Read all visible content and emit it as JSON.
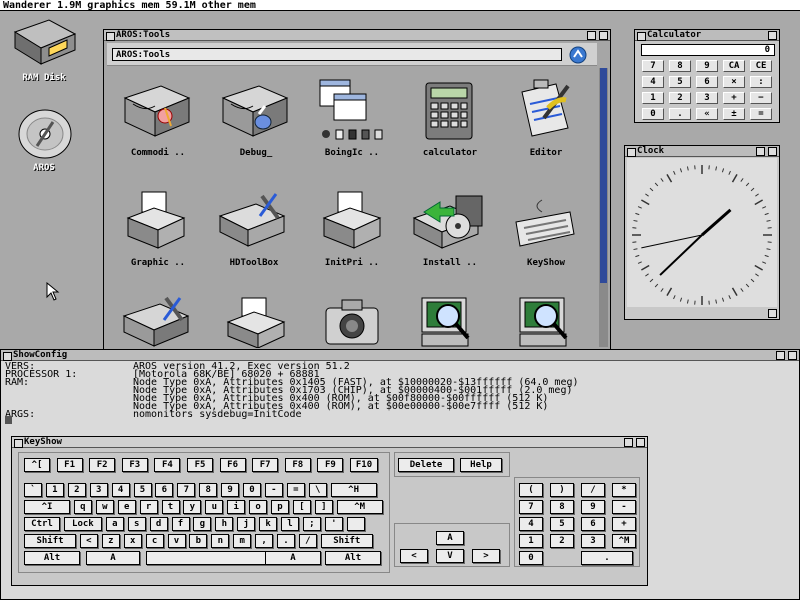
{
  "screen_title": "Wanderer 1.9M graphics mem 59.1M other mem",
  "desktop_icons": [
    {
      "label": "RAM Disk"
    },
    {
      "label": "AROS"
    }
  ],
  "tools_window": {
    "title": "AROS:Tools",
    "path": "AROS:Tools",
    "icons": [
      {
        "label": "Commodi .."
      },
      {
        "label": "Debug_"
      },
      {
        "label": "BoingIc .."
      },
      {
        "label": "calculator"
      },
      {
        "label": "Editor"
      },
      {
        "label": "Graphic .."
      },
      {
        "label": "HDToolBox"
      },
      {
        "label": "InitPri .."
      },
      {
        "label": "Install .."
      },
      {
        "label": "KeyShow"
      }
    ]
  },
  "calculator": {
    "title": "Calculator",
    "display": "0",
    "rows": [
      [
        "7",
        "8",
        "9",
        "CA",
        "CE"
      ],
      [
        "4",
        "5",
        "6",
        "×",
        ":"
      ],
      [
        "1",
        "2",
        "3",
        "+",
        "−"
      ],
      [
        "0",
        ".",
        "«",
        "±",
        "="
      ]
    ]
  },
  "clock": {
    "title": "Clock",
    "time": "01:37:43"
  },
  "showconfig": {
    "title": "ShowConfig",
    "lines": [
      {
        "label": "VERS:",
        "value": "AROS version 41.2, Exec version 51.2"
      },
      {
        "label": "PROCESSOR 1:",
        "value": "[Motorola 68K/BE] 68020 + 68881"
      },
      {
        "label": "RAM:",
        "value": "Node Type 0xA, Attributes 0x1405 (FAST), at $10000020-$13ffffff (64.0 meg)"
      },
      {
        "label": "",
        "value": "Node Type 0xA, Attributes 0x1703 (CHIP), at $00000400-$001fffff (2.0 meg)"
      },
      {
        "label": "",
        "value": "Node Type 0xA, Attributes 0x400 (ROM), at $00f80000-$00ffffff (512 K)"
      },
      {
        "label": "",
        "value": "Node Type 0xA, Attributes 0x400 (ROM), at $00e00000-$00e7ffff (512 K)"
      },
      {
        "label": "ARGS:",
        "value": "nomonitors sysdebug=InitCode"
      }
    ]
  },
  "keyshow": {
    "title": "KeyShow",
    "row1": [
      "^[",
      "F1",
      "F2",
      "F3",
      "F4",
      "F5",
      "F6",
      "F7",
      "F8",
      "F9",
      "F10"
    ],
    "row2": [
      "`",
      "1",
      "2",
      "3",
      "4",
      "5",
      "6",
      "7",
      "8",
      "9",
      "0",
      "-",
      "=",
      "\\",
      "^H"
    ],
    "row3": [
      "^I",
      "q",
      "w",
      "e",
      "r",
      "t",
      "y",
      "u",
      "i",
      "o",
      "p",
      "[",
      "]",
      "^M"
    ],
    "row4": [
      "Ctrl",
      "Lock",
      "a",
      "s",
      "d",
      "f",
      "g",
      "h",
      "j",
      "k",
      "l",
      ";",
      "'",
      ""
    ],
    "row5": [
      "Shift",
      "<",
      "z",
      "x",
      "c",
      "v",
      "b",
      "n",
      "m",
      ",",
      ".",
      "/",
      "Shift"
    ],
    "row6": [
      "Alt",
      "A",
      "",
      "A",
      "Alt"
    ],
    "delete": "Delete",
    "help": "Help",
    "arrows": {
      "up": "A",
      "left": "<",
      "down": "V",
      "right": ">"
    },
    "numpad": [
      [
        "(",
        ")",
        "/",
        "*"
      ],
      [
        "7",
        "8",
        "9",
        "-"
      ],
      [
        "4",
        "5",
        "6",
        "+"
      ],
      [
        "1",
        "2",
        "3",
        "^M"
      ],
      [
        "0",
        "."
      ]
    ]
  }
}
